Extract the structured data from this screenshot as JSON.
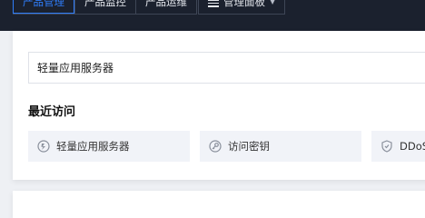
{
  "topnav": {
    "tabs": [
      {
        "label": "产品管理",
        "active": true
      },
      {
        "label": "产品监控",
        "active": false
      },
      {
        "label": "产品运维",
        "active": false
      }
    ],
    "panel_label": "管理面板"
  },
  "search": {
    "value": "轻量应用服务器"
  },
  "recent": {
    "title": "最近访问",
    "items": [
      {
        "label": "轻量应用服务器",
        "icon": "lightweight-server-icon"
      },
      {
        "label": "访问密钥",
        "icon": "access-key-icon"
      },
      {
        "label": "DDoS",
        "icon": "shield-icon"
      }
    ]
  },
  "colors": {
    "accent": "#2f7dfa",
    "topbar": "#1b212e"
  }
}
